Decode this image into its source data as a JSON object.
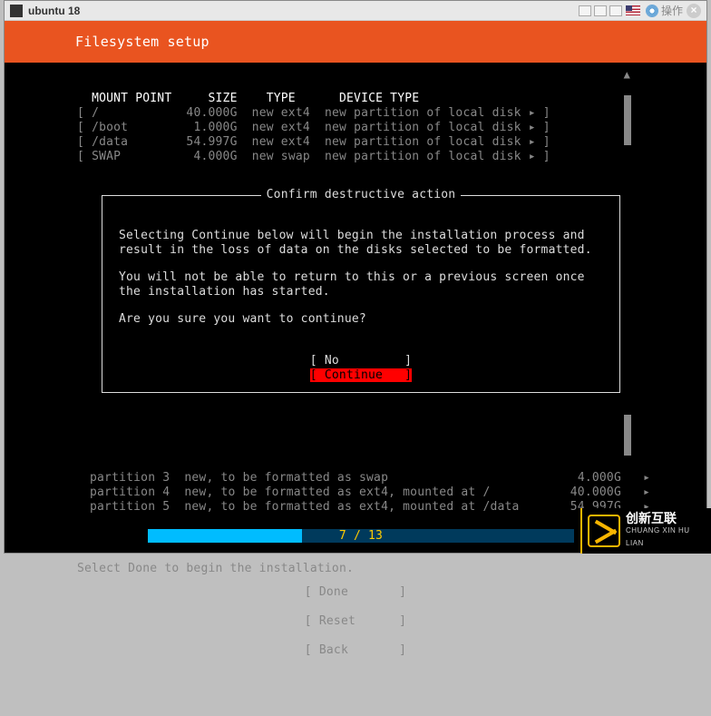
{
  "titlebar": {
    "title": "ubuntu 18",
    "action_label": "操作"
  },
  "header": {
    "title": "Filesystem setup"
  },
  "table": {
    "headers": {
      "mount": "MOUNT POINT",
      "size": "SIZE",
      "type": "TYPE",
      "devtype": "DEVICE TYPE"
    },
    "rows": [
      {
        "mount": "/",
        "size": "40.000G",
        "type": "new ext4",
        "devtype": "new partition of local disk"
      },
      {
        "mount": "/boot",
        "size": "1.000G",
        "type": "new ext4",
        "devtype": "new partition of local disk"
      },
      {
        "mount": "/data",
        "size": "54.997G",
        "type": "new ext4",
        "devtype": "new partition of local disk"
      },
      {
        "mount": "SWAP",
        "size": "4.000G",
        "type": "new swap",
        "devtype": "new partition of local disk"
      }
    ]
  },
  "dialog": {
    "title": "Confirm destructive action",
    "p1": "Selecting Continue below will begin the installation process and result in the loss of data on the disks selected to be formatted.",
    "p2": "You will not be able to return to this or a previous screen once the installation has started.",
    "p3": "Are you sure you want to continue?",
    "no_label": "No",
    "continue_label": "Continue"
  },
  "partitions": [
    {
      "name": "partition 3",
      "desc": "new, to be formatted as swap",
      "size": "4.000G"
    },
    {
      "name": "partition 4",
      "desc": "new, to be formatted as ext4, mounted at /",
      "size": "40.000G"
    },
    {
      "name": "partition 5",
      "desc": "new, to be formatted as ext4, mounted at /data",
      "size": "54.997G"
    }
  ],
  "footer": {
    "done": "Done",
    "reset": "Reset",
    "back": "Back"
  },
  "progress": {
    "current": 7,
    "total": 13,
    "text": "7 / 13"
  },
  "hint": "Select Done to begin the installation.",
  "watermark": {
    "cn": "创新互联",
    "en": "CHUANG XIN HU LIAN"
  }
}
